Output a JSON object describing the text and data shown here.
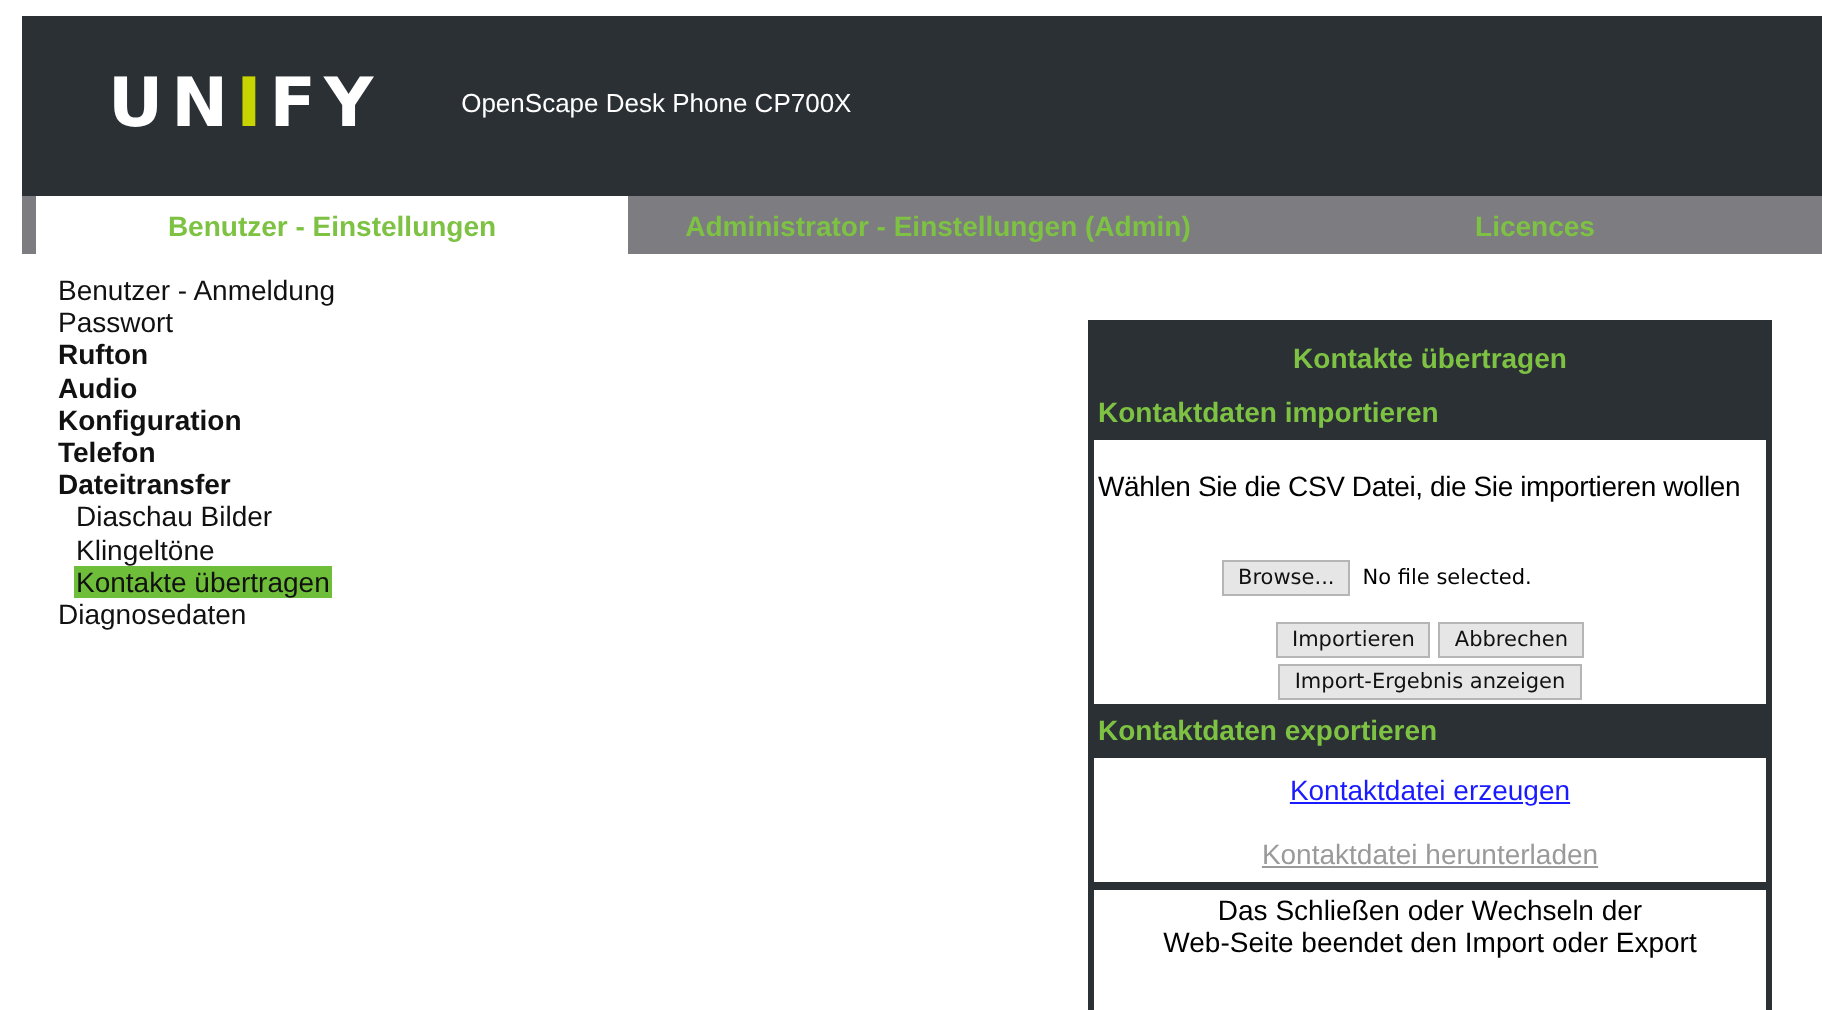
{
  "header": {
    "logo": "UNIFY",
    "product": "OpenScape Desk Phone CP700X"
  },
  "tabs": [
    {
      "label": "Benutzer - Einstellungen",
      "selected": true
    },
    {
      "label": "Administrator - Einstellungen (Admin)",
      "selected": false
    },
    {
      "label": "Licences",
      "selected": false
    }
  ],
  "sidebar": {
    "items": [
      {
        "label": "Benutzer - Anmeldung",
        "kind": "page",
        "selected": false
      },
      {
        "label": "Passwort",
        "kind": "page",
        "selected": false
      },
      {
        "label": "Rufton",
        "kind": "group",
        "selected": false
      },
      {
        "label": "Audio",
        "kind": "group",
        "selected": false
      },
      {
        "label": "Konfiguration",
        "kind": "group",
        "selected": false
      },
      {
        "label": "Telefon",
        "kind": "group",
        "selected": false
      },
      {
        "label": "Dateitransfer",
        "kind": "group",
        "selected": false
      },
      {
        "label": "Diaschau Bilder",
        "kind": "sub",
        "selected": false
      },
      {
        "label": "Klingeltöne",
        "kind": "sub",
        "selected": false
      },
      {
        "label": "Kontakte übertragen",
        "kind": "sub",
        "selected": true
      },
      {
        "label": "Diagnosedaten",
        "kind": "page",
        "selected": false
      }
    ]
  },
  "panel": {
    "title": "Kontakte übertragen",
    "import": {
      "heading": "Kontaktdaten importieren",
      "prompt": "Wählen Sie die CSV Datei, die Sie importieren wollen",
      "browse_button": "Browse...",
      "file_status": "No file selected.",
      "buttons": [
        "Importieren",
        "Abbrechen"
      ],
      "result_button": "Import-Ergebnis anzeigen"
    },
    "export": {
      "heading": "Kontaktdaten exportieren",
      "links": [
        {
          "label": "Kontaktdatei erzeugen",
          "disabled": false
        },
        {
          "label": "Kontaktdatei herunterladen",
          "disabled": true
        }
      ]
    },
    "note": [
      "Das Schließen oder Wechseln der",
      "Web-Seite beendet den Import oder Export"
    ]
  }
}
